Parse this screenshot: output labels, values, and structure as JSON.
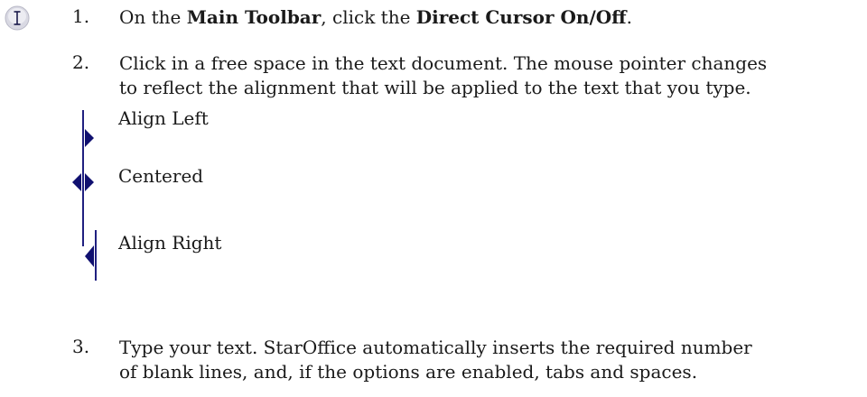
{
  "toolbar_icon": {
    "icon": "text-cursor-icon"
  },
  "steps": [
    {
      "number": "1.",
      "pre": "On the ",
      "bold1": "Main Toolbar",
      "mid": ", click the ",
      "bold2": "Direct Cursor On/Off",
      "post": "."
    },
    {
      "number": "2.",
      "line1": "Click in a free space in the text document. The mouse pointer changes",
      "line2": "to reflect the alignment that will be applied to the text that you type."
    },
    {
      "number": "3.",
      "line1": "Type your text. StarOffice automatically inserts the required number",
      "line2": "of blank lines, and, if the options are enabled, tabs and spaces."
    }
  ],
  "alignments": [
    {
      "label": "Align Left",
      "icon": "align-left-cursor-icon"
    },
    {
      "label": "Centered",
      "icon": "align-center-cursor-icon"
    },
    {
      "label": "Align Right",
      "icon": "align-right-cursor-icon"
    }
  ],
  "colors": {
    "arrow": "#101070",
    "bar": "#202080",
    "icon_bg": "#d8d8e0"
  }
}
